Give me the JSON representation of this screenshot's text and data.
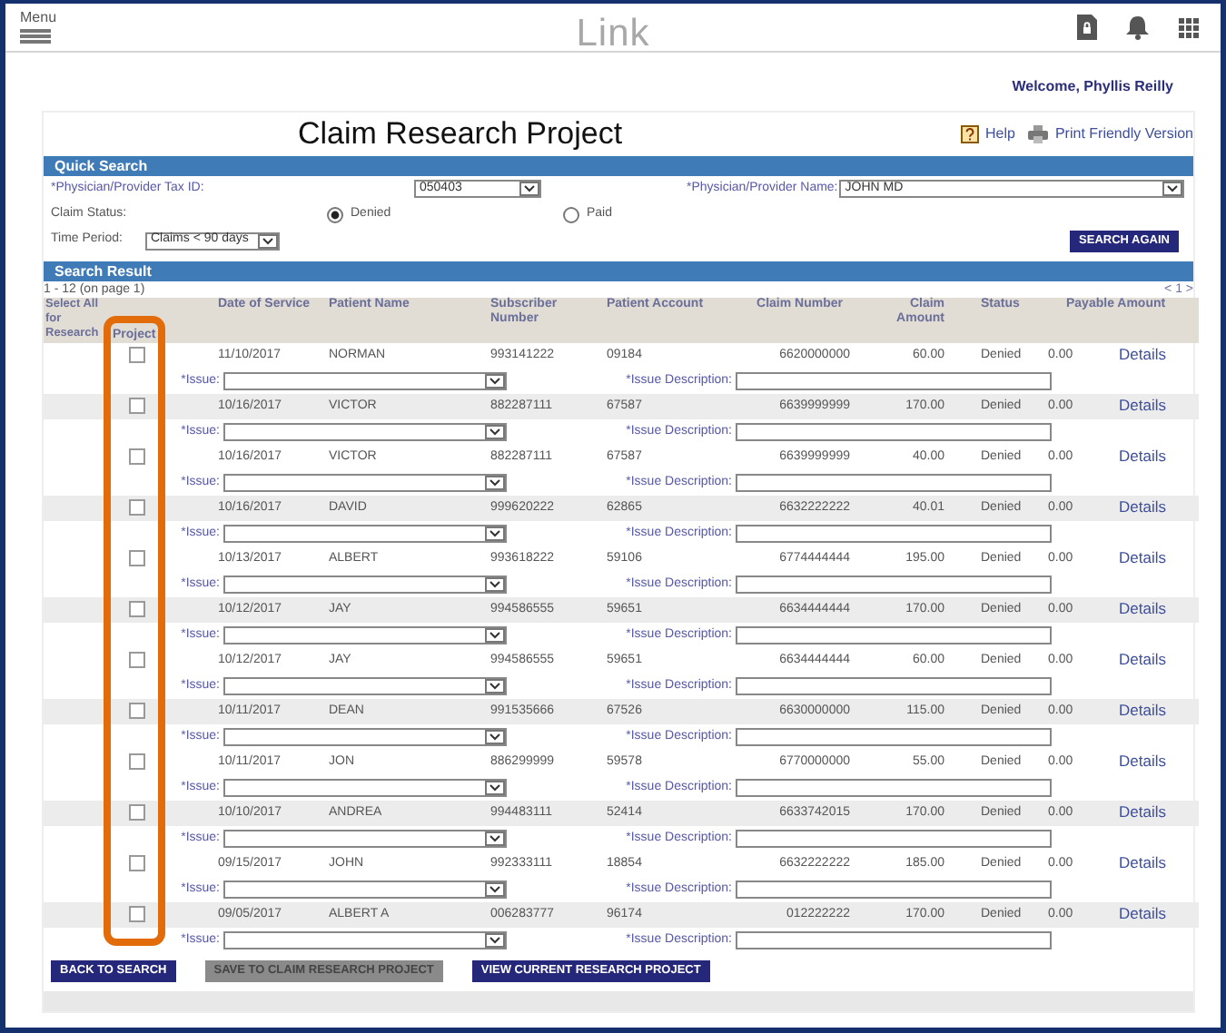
{
  "header": {
    "menu_label": "Menu",
    "logo": "Link"
  },
  "welcome": "Welcome, Phyllis Reilly",
  "page_title": "Claim Research Project",
  "help_label": "Help",
  "print_label": "Print Friendly Version",
  "quick_search": {
    "title": "Quick Search",
    "tax_id_label": "*Physician/Provider Tax ID:",
    "tax_id_value": "050403",
    "provider_name_label": "*Physician/Provider Name:",
    "provider_name_value": "JOHN MD",
    "claim_status_label": "Claim Status:",
    "claim_status_options": [
      {
        "label": "Denied",
        "selected": true
      },
      {
        "label": "Paid",
        "selected": false
      }
    ],
    "time_period_label": "Time Period:",
    "time_period_value": "Claims < 90 days",
    "search_button": "SEARCH AGAIN"
  },
  "search_result": {
    "title": "Search Result",
    "range": "1 - 12 (on page 1)",
    "pager": "< 1 >",
    "project_column_highlighted": true,
    "columns": [
      "Select All for Research",
      "Project",
      "Date of Service",
      "Patient Name",
      "Subscriber Number",
      "Patient Account",
      "Claim Number",
      "Claim Amount",
      "Status",
      "Payable Amount"
    ],
    "rows": [
      {
        "checked": false,
        "date": "11/10/2017",
        "patient": "NORMAN",
        "subscriber": "993141222",
        "account": "09184",
        "claim_number": "6620000000",
        "amount": "60.00",
        "status": "Denied",
        "payable": "0.00",
        "details": "Details",
        "issue_label": "*Issue:",
        "issue_description_label": "*Issue Description:"
      },
      {
        "checked": false,
        "date": "10/16/2017",
        "patient": "VICTOR",
        "subscriber": "882287111",
        "account": "67587",
        "claim_number": "6639999999",
        "amount": "170.00",
        "status": "Denied",
        "payable": "0.00",
        "details": "Details",
        "issue_label": "*Issue:",
        "issue_description_label": "*Issue Description:"
      },
      {
        "checked": false,
        "date": "10/16/2017",
        "patient": "VICTOR",
        "subscriber": "882287111",
        "account": "67587",
        "claim_number": "6639999999",
        "amount": "40.00",
        "status": "Denied",
        "payable": "0.00",
        "details": "Details",
        "issue_label": "*Issue:",
        "issue_description_label": "*Issue Description:"
      },
      {
        "checked": false,
        "date": "10/16/2017",
        "patient": "DAVID",
        "subscriber": "999620222",
        "account": "62865",
        "claim_number": "6632222222",
        "amount": "40.01",
        "status": "Denied",
        "payable": "0.00",
        "details": "Details",
        "issue_label": "*Issue:",
        "issue_description_label": "*Issue Description:"
      },
      {
        "checked": false,
        "date": "10/13/2017",
        "patient": "ALBERT",
        "subscriber": "993618222",
        "account": "59106",
        "claim_number": "6774444444",
        "amount": "195.00",
        "status": "Denied",
        "payable": "0.00",
        "details": "Details",
        "issue_label": "*Issue:",
        "issue_description_label": "*Issue Description:"
      },
      {
        "checked": false,
        "date": "10/12/2017",
        "patient": "JAY",
        "subscriber": "994586555",
        "account": "59651",
        "claim_number": "6634444444",
        "amount": "170.00",
        "status": "Denied",
        "payable": "0.00",
        "details": "Details",
        "issue_label": "*Issue:",
        "issue_description_label": "*Issue Description:"
      },
      {
        "checked": false,
        "date": "10/12/2017",
        "patient": "JAY",
        "subscriber": "994586555",
        "account": "59651",
        "claim_number": "6634444444",
        "amount": "60.00",
        "status": "Denied",
        "payable": "0.00",
        "details": "Details",
        "issue_label": "*Issue:",
        "issue_description_label": "*Issue Description:"
      },
      {
        "checked": false,
        "date": "10/11/2017",
        "patient": "DEAN",
        "subscriber": "991535666",
        "account": "67526",
        "claim_number": "6630000000",
        "amount": "115.00",
        "status": "Denied",
        "payable": "0.00",
        "details": "Details",
        "issue_label": "*Issue:",
        "issue_description_label": "*Issue Description:"
      },
      {
        "checked": false,
        "date": "10/11/2017",
        "patient": "JON",
        "subscriber": "886299999",
        "account": "59578",
        "claim_number": "6770000000",
        "amount": "55.00",
        "status": "Denied",
        "payable": "0.00",
        "details": "Details",
        "issue_label": "*Issue:",
        "issue_description_label": "*Issue Description:"
      },
      {
        "checked": false,
        "date": "10/10/2017",
        "patient": "ANDREA",
        "subscriber": "994483111",
        "account": "52414",
        "claim_number": "6633742015",
        "amount": "170.00",
        "status": "Denied",
        "payable": "0.00",
        "details": "Details",
        "issue_label": "*Issue:",
        "issue_description_label": "*Issue Description:"
      },
      {
        "checked": false,
        "date": "09/15/2017",
        "patient": "JOHN",
        "subscriber": "992333111",
        "account": "18854",
        "claim_number": "6632222222",
        "amount": "185.00",
        "status": "Denied",
        "payable": "0.00",
        "details": "Details",
        "issue_label": "*Issue:",
        "issue_description_label": "*Issue Description:"
      },
      {
        "checked": false,
        "date": "09/05/2017",
        "patient": "ALBERT A",
        "subscriber": "006283777",
        "account": "96174",
        "claim_number": "012222222",
        "amount": "170.00",
        "status": "Denied",
        "payable": "0.00",
        "details": "Details",
        "issue_label": "*Issue:",
        "issue_description_label": "*Issue Description:"
      }
    ]
  },
  "buttons": [
    {
      "label": "BACK TO SEARCH",
      "disabled": false
    },
    {
      "label": "SAVE TO CLAIM RESEARCH PROJECT",
      "disabled": true
    },
    {
      "label": "VIEW CURRENT RESEARCH PROJECT",
      "disabled": false
    }
  ]
}
